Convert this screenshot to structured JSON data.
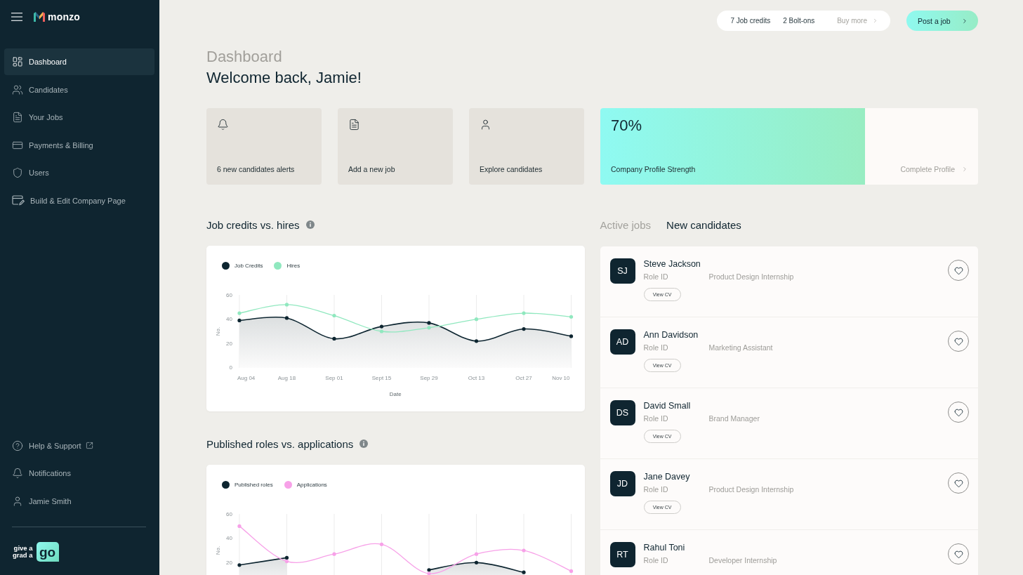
{
  "sidebar": {
    "logo": "monzo",
    "nav": [
      {
        "label": "Dashboard",
        "selected": true
      },
      {
        "label": "Candidates",
        "selected": false
      },
      {
        "label": "Your Jobs",
        "selected": false
      },
      {
        "label": "Payments & Billing",
        "selected": false
      },
      {
        "label": "Users",
        "selected": false
      },
      {
        "label": "Build & Edit Company Page",
        "selected": false
      }
    ],
    "footer_nav": [
      {
        "label": "Help & Support",
        "external": true
      },
      {
        "label": "Notifications",
        "external": false
      },
      {
        "label": "Jamie Smith",
        "external": false
      }
    ],
    "brand": {
      "lines": [
        "give a",
        "grad a"
      ],
      "badge": "go"
    }
  },
  "topbar": {
    "credits": [
      "7 Job credits",
      "2 Bolt-ons"
    ],
    "buy_more": "Buy more",
    "post_job": "Post a job"
  },
  "header": {
    "section": "Dashboard",
    "greeting": "Welcome back, Jamie!"
  },
  "quick_actions": [
    {
      "label": "6 new candidates alerts"
    },
    {
      "label": "Add a new job"
    },
    {
      "label": "Explore candidates"
    }
  ],
  "profile": {
    "value": "70%",
    "label": "Company Profile Strength",
    "level": 0.7,
    "action": "Complete Profile"
  },
  "charts": [
    {
      "chart_data": {
        "type": "line",
        "title": "Job credits vs. hires",
        "xlabel": "Date",
        "ylabel": "No.",
        "categories": [
          "Aug 04",
          "Aug 18",
          "Sep 01",
          "Sept 15",
          "Sep 29",
          "Oct 13",
          "Oct 27",
          "Nov 10"
        ],
        "series": [
          {
            "name": "Job Credits",
            "color": "#0d2530",
            "type": "area",
            "values": [
              39,
              41,
              24,
              34,
              37,
              22,
              32,
              26
            ]
          },
          {
            "name": "Hires",
            "color": "#90e8bf",
            "type": "line",
            "values": [
              45,
              52,
              43,
              30,
              33,
              40,
              45,
              42
            ]
          }
        ],
        "ylim": [
          0,
          60
        ],
        "yticks": [
          0,
          20,
          40,
          60
        ],
        "grid": true,
        "legend": "top-left"
      }
    },
    {
      "chart_data": {
        "type": "line",
        "title": "Published roles vs. applications",
        "ylabel": "No.",
        "series": [
          {
            "name": "Published roles",
            "color": "#0d2530",
            "type": "area",
            "values": [
              18,
              24,
              null,
              null,
              14,
              20,
              12,
              null
            ]
          },
          {
            "name": "Applications",
            "color": "#f7a1e8",
            "type": "line",
            "values": [
              50,
              21,
              27,
              35,
              11,
              27,
              30,
              13
            ]
          }
        ],
        "ylim": [
          0,
          60
        ],
        "yticks": [
          20,
          40,
          60
        ],
        "grid": true,
        "legend": "top-left"
      }
    }
  ],
  "candidates": {
    "tabs": [
      {
        "label": "Active jobs",
        "selected": false
      },
      {
        "label": "New candidates",
        "selected": true
      }
    ],
    "rows": [
      {
        "initials": "SJ",
        "name": "Steve Jackson",
        "role_label": "Role ID",
        "role": "Product Design Internship",
        "button": "View CV",
        "saved": false
      },
      {
        "initials": "AD",
        "name": "Ann Davidson",
        "role_label": "Role ID",
        "role": "Marketing Assistant",
        "button": "View CV",
        "saved": false
      },
      {
        "initials": "DS",
        "name": "David Small",
        "role_label": "Role ID",
        "role": "Brand Manager",
        "button": "View CV",
        "saved": false
      },
      {
        "initials": "JD",
        "name": "Jane Davey",
        "role_label": "Role ID",
        "role": "Product Design Internship",
        "button": "View CV",
        "saved": false
      },
      {
        "initials": "RT",
        "name": "Rahul Toni",
        "role_label": "Role ID",
        "role": "Developer Internship",
        "saved": false
      }
    ]
  }
}
